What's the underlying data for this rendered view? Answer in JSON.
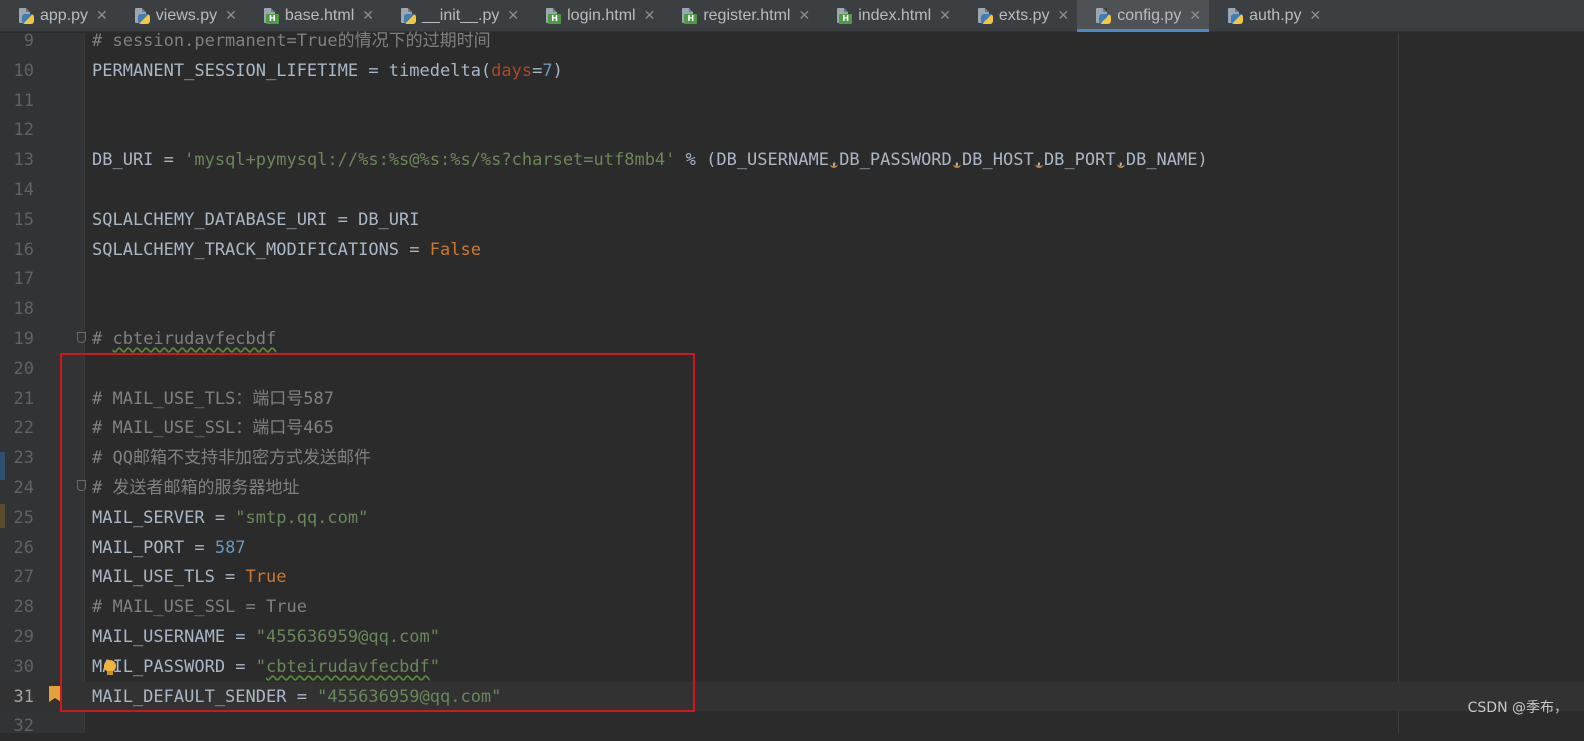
{
  "tabs": [
    {
      "name": "app.py",
      "type": "py",
      "active": false
    },
    {
      "name": "views.py",
      "type": "py",
      "active": false
    },
    {
      "name": "base.html",
      "type": "html",
      "active": false
    },
    {
      "name": "__init__.py",
      "type": "py",
      "active": false
    },
    {
      "name": "login.html",
      "type": "html",
      "active": false
    },
    {
      "name": "register.html",
      "type": "html",
      "active": false
    },
    {
      "name": "index.html",
      "type": "html",
      "active": false
    },
    {
      "name": "exts.py",
      "type": "py",
      "active": false
    },
    {
      "name": "config.py",
      "type": "py",
      "active": true
    },
    {
      "name": "auth.py",
      "type": "py",
      "active": false
    }
  ],
  "tab_close_glyph": "✕",
  "html_badge": "H",
  "editor": {
    "current_line": 31,
    "lines": [
      {
        "n": "9",
        "tokens": [
          {
            "t": "# session.permanent=True的情况下的过期时间",
            "c": "comment"
          }
        ]
      },
      {
        "n": "10",
        "tokens": [
          {
            "t": "PERMANENT_SESSION_LIFETIME = timedelta("
          },
          {
            "t": "days",
            "c": "param"
          },
          {
            "t": "="
          },
          {
            "t": "7",
            "c": "num"
          },
          {
            "t": ")"
          }
        ]
      },
      {
        "n": "11",
        "tokens": []
      },
      {
        "n": "12",
        "tokens": []
      },
      {
        "n": "13",
        "tokens": [
          {
            "t": "DB_URI = "
          },
          {
            "t": "'mysql+pymysql://%s:%s@%s:%s/%s?charset=utf8mb4'",
            "c": "str"
          },
          {
            "t": " % (DB_USERNAME"
          },
          {
            "t": ",",
            "c": "sep"
          },
          {
            "t": "DB_PASSWORD"
          },
          {
            "t": ",",
            "c": "sep"
          },
          {
            "t": "DB_HOST"
          },
          {
            "t": ",",
            "c": "sep"
          },
          {
            "t": "DB_PORT"
          },
          {
            "t": ",",
            "c": "sep"
          },
          {
            "t": "DB_NAME)"
          }
        ]
      },
      {
        "n": "14",
        "tokens": []
      },
      {
        "n": "15",
        "tokens": [
          {
            "t": "SQLALCHEMY_DATABASE_URI = DB_URI"
          }
        ]
      },
      {
        "n": "16",
        "tokens": [
          {
            "t": "SQLALCHEMY_TRACK_MODIFICATIONS = "
          },
          {
            "t": "False",
            "c": "kw"
          }
        ]
      },
      {
        "n": "17",
        "tokens": []
      },
      {
        "n": "18",
        "tokens": []
      },
      {
        "n": "19",
        "tokens": [
          {
            "t": "# ",
            "c": "comment"
          },
          {
            "t": "cbteirudavfecbdf",
            "c": "comment typo"
          }
        ]
      },
      {
        "n": "20",
        "tokens": []
      },
      {
        "n": "21",
        "tokens": [
          {
            "t": "# MAIL_USE_TLS：端口号587",
            "c": "comment"
          }
        ]
      },
      {
        "n": "22",
        "tokens": [
          {
            "t": "# MAIL_USE_SSL：端口号465",
            "c": "comment"
          }
        ]
      },
      {
        "n": "23",
        "tokens": [
          {
            "t": "# QQ邮箱不支持非加密方式发送邮件",
            "c": "comment"
          }
        ]
      },
      {
        "n": "24",
        "tokens": [
          {
            "t": "# 发送者邮箱的服务器地址",
            "c": "comment"
          }
        ]
      },
      {
        "n": "25",
        "tokens": [
          {
            "t": "MAIL_SERVER = "
          },
          {
            "t": "\"smtp.qq.com\"",
            "c": "str"
          }
        ]
      },
      {
        "n": "26",
        "tokens": [
          {
            "t": "MAIL_PORT = "
          },
          {
            "t": "587",
            "c": "num"
          }
        ]
      },
      {
        "n": "27",
        "tokens": [
          {
            "t": "MAIL_USE_TLS = "
          },
          {
            "t": "True",
            "c": "kw"
          }
        ]
      },
      {
        "n": "28",
        "tokens": [
          {
            "t": "# MAIL_USE_SSL = True",
            "c": "comment"
          }
        ]
      },
      {
        "n": "29",
        "tokens": [
          {
            "t": "MAIL_USERNAME = "
          },
          {
            "t": "\"455636959@qq.com\"",
            "c": "str"
          }
        ]
      },
      {
        "n": "30",
        "tokens": [
          {
            "t": "MAIL_PASSWORD = "
          },
          {
            "t": "\"",
            "c": "str"
          },
          {
            "t": "cbteirudavfecbdf",
            "c": "str typo"
          },
          {
            "t": "\"",
            "c": "str"
          }
        ]
      },
      {
        "n": "31",
        "tokens": [
          {
            "t": "MAIL_DEFAULT_SENDER = "
          },
          {
            "t": "\"455636959@qq.com\"",
            "c": "str"
          }
        ]
      },
      {
        "n": "32",
        "tokens": []
      }
    ]
  },
  "watermark": "CSDN @季布，"
}
